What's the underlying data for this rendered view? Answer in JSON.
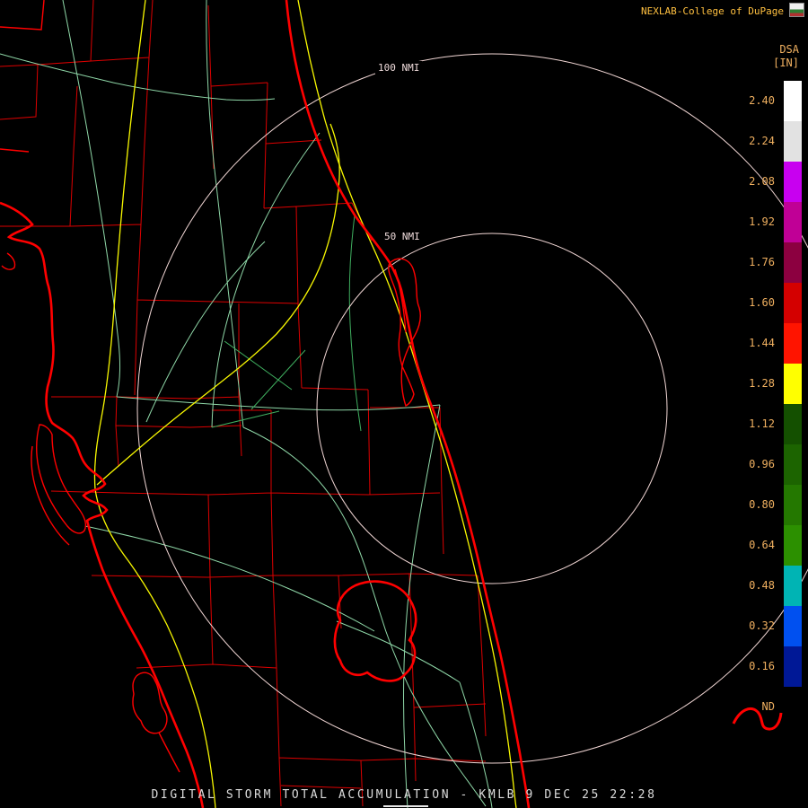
{
  "header": {
    "brand": "NEXLAB-College of DuPage",
    "logo_name": "college-of-dupage-logo"
  },
  "product": {
    "code": "DSA",
    "units": "[IN]"
  },
  "rings": {
    "outer_label": "100 NMI",
    "inner_label": "50 NMI"
  },
  "footer": {
    "caption": "DIGITAL STORM TOTAL ACCUMULATION - KMLB 9 DEC 25 22:28"
  },
  "colorbar": {
    "labels": [
      "2.40",
      "2.24",
      "2.08",
      "1.92",
      "1.76",
      "1.60",
      "1.44",
      "1.28",
      "1.12",
      "0.96",
      "0.80",
      "0.64",
      "0.48",
      "0.32",
      "0.16",
      "ND"
    ],
    "colors": [
      "#ffffff",
      "#e2e2e2",
      "#c800f0",
      "#c00096",
      "#8c0040",
      "#d40000",
      "#ff1400",
      "#ffff00",
      "#145000",
      "#1c6400",
      "#247800",
      "#2c9000",
      "#00b4b4",
      "#0050f0",
      "#001896",
      "#000000"
    ],
    "units": "IN"
  },
  "colors": {
    "background": "#000000",
    "county_border": "#dd0000",
    "coastline": "#ff0000",
    "interstate": "#f8f800",
    "road": "#8fd8a8",
    "road_alt": "#3fae5f",
    "range_ring": "#f2d7d5",
    "ring_text": "#f0dcdc",
    "scale_label_text": "#f0b060",
    "brand_text": "#ffc040",
    "footer_text": "#dcdcdc"
  }
}
